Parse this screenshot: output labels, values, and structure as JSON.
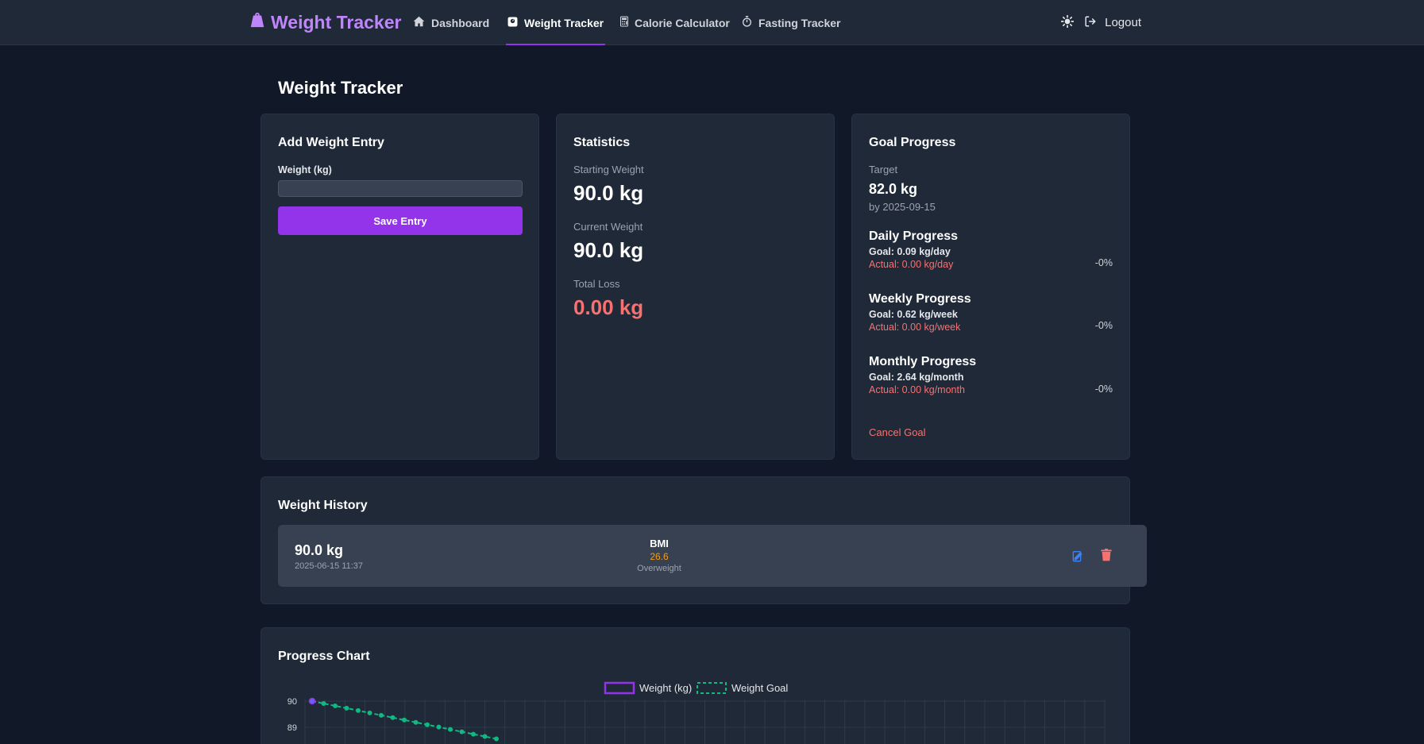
{
  "nav": {
    "brand": "Weight Tracker",
    "links": [
      "Dashboard",
      "Weight Tracker",
      "Calorie Calculator",
      "Fasting Tracker"
    ],
    "logout": "Logout"
  },
  "page": {
    "title": "Weight Tracker"
  },
  "add_entry": {
    "title": "Add Weight Entry",
    "field_label": "Weight (kg)",
    "field_value": "",
    "save_label": "Save Entry"
  },
  "statistics": {
    "title": "Statistics",
    "starting_label": "Starting Weight",
    "starting_value": "90.0 kg",
    "current_label": "Current Weight",
    "current_value": "90.0 kg",
    "loss_label": "Total Loss",
    "loss_value": "0.00 kg"
  },
  "goal": {
    "title": "Goal Progress",
    "target_label": "Target",
    "target_value": "82.0 kg",
    "target_date": "by 2025-09-15",
    "daily": {
      "title": "Daily Progress",
      "goal": "Goal: 0.09 kg/day",
      "actual": "Actual: 0.00 kg/day",
      "pct": "-0%"
    },
    "weekly": {
      "title": "Weekly Progress",
      "goal": "Goal: 0.62 kg/week",
      "actual": "Actual: 0.00 kg/week",
      "pct": "-0%"
    },
    "monthly": {
      "title": "Monthly Progress",
      "goal": "Goal: 2.64 kg/month",
      "actual": "Actual: 0.00 kg/month",
      "pct": "-0%"
    },
    "cancel_label": "Cancel Goal"
  },
  "history": {
    "title": "Weight History",
    "entries": [
      {
        "weight": "90.0 kg",
        "datetime": "2025-06-15 11:37",
        "bmi_label": "BMI",
        "bmi_value": "26.6",
        "bmi_category": "Overweight"
      }
    ]
  },
  "colors": {
    "accent": "#9333ea",
    "brand": "#c084fc",
    "danger": "#f87171",
    "bmi": "#f59e0b",
    "goal_line": "#10b981",
    "edit": "#3b82f6"
  },
  "chart_data": {
    "type": "line",
    "title": "Progress Chart",
    "legend": [
      "Weight (kg)",
      "Weight Goal"
    ],
    "legend_position": "top-center",
    "y_ticks": [
      "90",
      "89"
    ],
    "ylim": [
      88.5,
      90
    ],
    "grid": true,
    "series": [
      {
        "name": "Weight (kg)",
        "values": [
          90.0
        ]
      },
      {
        "name": "Weight Goal",
        "values": [
          90.0,
          89.91,
          89.82,
          89.73,
          89.64,
          89.55,
          89.46,
          89.37,
          89.28,
          89.19,
          89.1,
          89.01,
          88.92,
          88.83,
          88.74,
          88.65,
          88.56
        ]
      }
    ]
  }
}
